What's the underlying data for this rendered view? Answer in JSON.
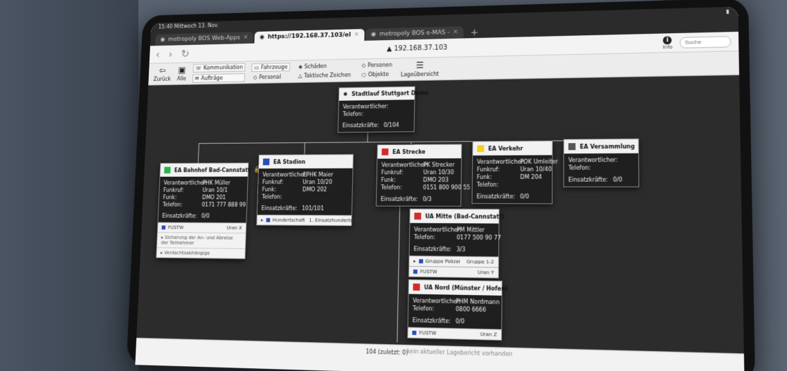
{
  "statusbar": {
    "time": "15:40",
    "date": "Mittwoch 13. Nov."
  },
  "tabs": [
    {
      "label": "metropoly BOS Web-Apps"
    },
    {
      "label": "https://192.168.37.103/el"
    },
    {
      "label": "metropoly BOS e-MAS -"
    }
  ],
  "address": {
    "url": "192.168.37.103",
    "info_label": "Info",
    "search_placeholder": "Suche"
  },
  "toolbar": {
    "back": "Zurück",
    "all": "Alle",
    "kommunikation": "Kommunikation",
    "auftraege": "Aufträge",
    "fahrzeuge": "Fahrzeuge",
    "personal": "Personal",
    "schaeden": "Schäden",
    "taktische": "Taktische Zeichen",
    "personen": "Personen",
    "objekte": "Objekte",
    "lage": "Lageübersicht"
  },
  "colors": {
    "green": "#2bb34a",
    "blue": "#2a4fb5",
    "red": "#d42a2a",
    "yellow": "#f2d21b",
    "gray": "#555555"
  },
  "root": {
    "title": "Stadtlauf Stuttgart Demo",
    "verantwortlicher_label": "Verantwortlicher:",
    "telefon_label": "Telefon:",
    "einsatz_label": "Einsatzkräfte:",
    "einsatz_value": "0/104"
  },
  "bahnhof": {
    "title": "EA Bahnhof Bad-Cannstatt",
    "verantwortlicher": "PHK Müller",
    "funkruf": "Uran 10/1",
    "funk": "DMO 201",
    "telefon": "0171 777 888 99",
    "einsatz": "0/0",
    "sub_name": "FUSTW",
    "sub_val": "Uran X",
    "note1": "Sicherung der An- und Abreise der Teilnehmer",
    "note2": "Verdachtsabhängige"
  },
  "stadion": {
    "title": "EA Stadion",
    "verantwortlicher": "EPHK Maier",
    "funkruf": "Uran 10/20",
    "funk": "DMO 202",
    "telefon": "",
    "einsatz": "101/101",
    "sub_name": "Hundertschaft",
    "sub_val": "1. Einsatzhundertschaft"
  },
  "strecke": {
    "title": "EA Strecke",
    "verantwortlicher": "PK Strecker",
    "funkruf": "Uran 10/30",
    "funk": "DMO 203",
    "telefon": "0151 800 900 55",
    "einsatz": "0/3"
  },
  "verkehr": {
    "title": "EA Verkehr",
    "verantwortlicher": "POK Umleiter",
    "funkruf": "Uran 10/40",
    "funk": "DM 204",
    "einsatz": "0/0"
  },
  "versammlung": {
    "title": "EA Versammlung",
    "einsatz": "0/0"
  },
  "mitte": {
    "title": "UA Mitte (Bad-Cannstatt)",
    "verantwortlicher": "PM Mittler",
    "telefon": "0177 500 90 77",
    "einsatz": "3/3",
    "sub1_name": "Gruppe Polizei",
    "sub1_val": "Gruppe 1-2",
    "sub2_name": "FUSTW",
    "sub2_val": "Uran Y"
  },
  "nord": {
    "title": "UA Nord (Münster / Hofen)",
    "verantwortlicher": "PHM Nordmann",
    "telefon": "0800 6666",
    "einsatz": "0/0",
    "sub_name": "FUSTW",
    "sub_val": "Uran Z"
  },
  "labels": {
    "verantwortlicher": "Verantwortlicher:",
    "funkruf": "Funkruf:",
    "funk": "Funk:",
    "telefon": "Telefon:",
    "einsatz": "Einsatzkräfte:"
  },
  "bottom": {
    "count": "104 (zuletzt: 0)",
    "lage": "kein aktueller Lagebericht vorhanden"
  }
}
